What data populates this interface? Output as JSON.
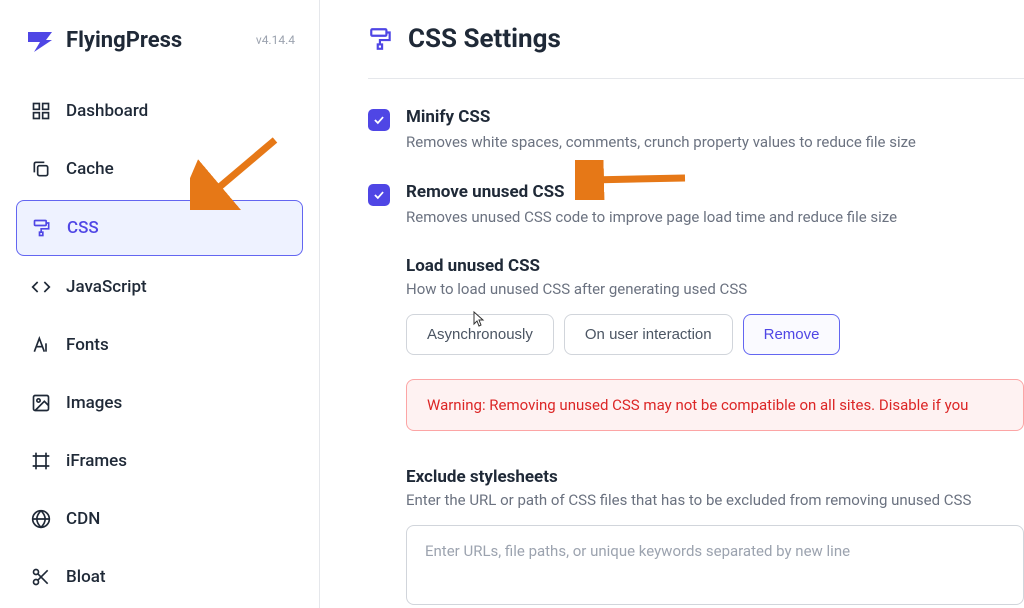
{
  "brand": {
    "name": "FlyingPress",
    "version": "v4.14.4"
  },
  "nav": {
    "items": [
      {
        "icon": "dashboard",
        "label": "Dashboard"
      },
      {
        "icon": "cache",
        "label": "Cache"
      },
      {
        "icon": "css",
        "label": "CSS"
      },
      {
        "icon": "js",
        "label": "JavaScript"
      },
      {
        "icon": "fonts",
        "label": "Fonts"
      },
      {
        "icon": "images",
        "label": "Images"
      },
      {
        "icon": "iframes",
        "label": "iFrames"
      },
      {
        "icon": "cdn",
        "label": "CDN"
      },
      {
        "icon": "bloat",
        "label": "Bloat"
      }
    ],
    "activeIndex": 2
  },
  "page": {
    "title": "CSS Settings"
  },
  "settings": {
    "minify": {
      "title": "Minify CSS",
      "desc": "Removes white spaces, comments, crunch property values to reduce file size",
      "checked": true
    },
    "removeUnused": {
      "title": "Remove unused CSS",
      "desc": "Removes unused CSS code to improve page load time and reduce file size",
      "checked": true
    },
    "loadUnused": {
      "title": "Load unused CSS",
      "desc": "How to load unused CSS after generating used CSS",
      "options": [
        "Asynchronously",
        "On user interaction",
        "Remove"
      ],
      "selectedIndex": 2
    },
    "warning": "Warning: Removing unused CSS may not be compatible on all sites. Disable if you",
    "exclude": {
      "title": "Exclude stylesheets",
      "desc": "Enter the URL or path of CSS files that has to be excluded from removing unused CSS",
      "placeholder": "Enter URLs, file paths, or unique keywords separated by new line"
    }
  }
}
